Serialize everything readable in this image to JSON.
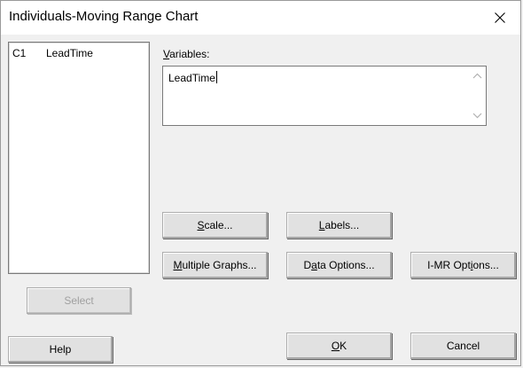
{
  "window": {
    "title": "Individuals-Moving Range Chart"
  },
  "varlist": {
    "items": [
      {
        "column": "C1",
        "name": "LeadTime"
      }
    ]
  },
  "variables": {
    "label_pre": "",
    "label_ul": "V",
    "label_post": "ariables:",
    "value": "LeadTime"
  },
  "buttons": {
    "scale": {
      "pre": "",
      "ul": "S",
      "post": "cale..."
    },
    "labels": {
      "pre": "",
      "ul": "L",
      "post": "abels..."
    },
    "multiple_graphs": {
      "pre": "",
      "ul": "M",
      "post": "ultiple Graphs..."
    },
    "data_options": {
      "pre": "D",
      "ul": "a",
      "post": "ta Options..."
    },
    "imr_options": {
      "pre": "I-MR Opt",
      "ul": "i",
      "post": "ons..."
    },
    "select": "Select",
    "help": "Help",
    "ok": {
      "pre": "",
      "ul": "O",
      "post": "K"
    },
    "cancel": "Cancel"
  }
}
